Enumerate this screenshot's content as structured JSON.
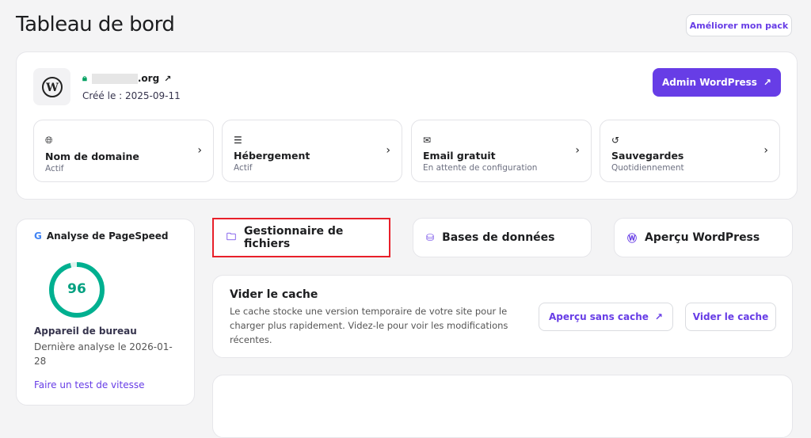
{
  "header": {
    "title": "Tableau de bord",
    "upgrade_label": "Améliorer mon pack"
  },
  "site": {
    "domain_suffix": ".org",
    "created": "Créé le : 2025-09-11",
    "admin_label": "Admin WordPress"
  },
  "tiles": [
    {
      "title": "Nom de domaine",
      "status": "Actif",
      "icon": "globe-icon"
    },
    {
      "title": "Hébergement",
      "status": "Actif",
      "icon": "server-icon"
    },
    {
      "title": "Email gratuit",
      "status": "En attente de configuration",
      "icon": "mail-icon"
    },
    {
      "title": "Sauvegardes",
      "status": "Quotidiennement",
      "icon": "history-icon"
    }
  ],
  "pagespeed": {
    "title": "Analyse de PageSpeed",
    "score": "96",
    "score_value": 96,
    "device": "Appareil de bureau",
    "last": "Dernière analyse le 2026-01-28",
    "link": "Faire un test de vitesse",
    "color": "#00b090"
  },
  "quick": [
    {
      "label": "Gestionnaire de fichiers"
    },
    {
      "label": "Bases de données"
    },
    {
      "label": "Aperçu WordPress"
    }
  ],
  "cache": {
    "title": "Vider le cache",
    "desc": "Le cache stocke une version temporaire de votre site pour le charger plus rapidement. Videz-le pour voir les modifications récentes.",
    "preview_label": "Aperçu sans cache",
    "clear_label": "Vider le cache"
  },
  "colors": {
    "accent": "#673de6",
    "highlight": "#e8202a"
  }
}
